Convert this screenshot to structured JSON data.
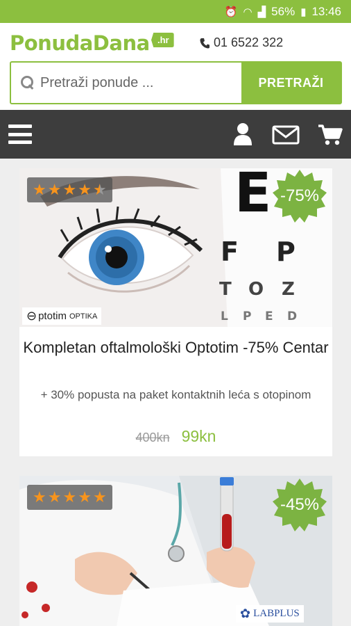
{
  "status_bar": {
    "battery": "56%",
    "time": "13:46"
  },
  "header": {
    "logo": "PonudaDana",
    "logo_badge": ".hr",
    "phone": "01 6522 322"
  },
  "search": {
    "placeholder": "Pretraži ponude ...",
    "button_label": "PRETRAŽI"
  },
  "deals": [
    {
      "rating": 4.5,
      "discount": "-75%",
      "brand": "ptotim",
      "brand_suffix": "OPTIKA",
      "title": "Kompletan oftalmološki Optotim -75% Centar",
      "subtitle": "+ 30% popusta na paket kontaktnih leća s otopinom",
      "old_price": "400kn",
      "new_price": "99kn"
    },
    {
      "rating": 5,
      "discount": "-45%",
      "brand": "LABPLUS"
    }
  ],
  "colors": {
    "accent": "#8cbf3f",
    "nav": "#3d3d3d",
    "star": "#f7941d"
  }
}
